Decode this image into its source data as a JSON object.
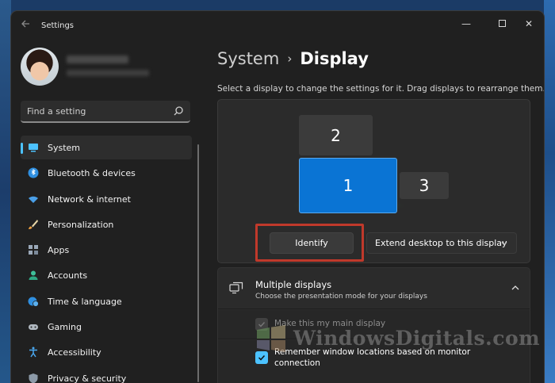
{
  "window": {
    "app_title": "Settings",
    "back_icon": "arrow-left-icon",
    "controls": {
      "minimize": "—",
      "close": "✕"
    }
  },
  "profile": {
    "name": "███████",
    "email": "████████████████"
  },
  "search": {
    "placeholder": "Find a setting",
    "icon": "search-icon"
  },
  "sidebar": {
    "items": [
      {
        "label": "System",
        "icon": "monitor-icon",
        "active": true
      },
      {
        "label": "Bluetooth & devices",
        "icon": "bluetooth-icon"
      },
      {
        "label": "Network & internet",
        "icon": "wifi-icon"
      },
      {
        "label": "Personalization",
        "icon": "brush-icon"
      },
      {
        "label": "Apps",
        "icon": "apps-icon"
      },
      {
        "label": "Accounts",
        "icon": "person-icon"
      },
      {
        "label": "Time & language",
        "icon": "globe-clock-icon"
      },
      {
        "label": "Gaming",
        "icon": "gamepad-icon"
      },
      {
        "label": "Accessibility",
        "icon": "accessibility-icon"
      },
      {
        "label": "Privacy & security",
        "icon": "shield-icon"
      }
    ]
  },
  "main": {
    "breadcrumb": {
      "parent": "System",
      "separator": "›",
      "current": "Display"
    },
    "instructions": "Select a display to change the settings for it. Drag displays to rearrange them.",
    "monitors": [
      {
        "number": "2",
        "selected": false
      },
      {
        "number": "1",
        "selected": true
      },
      {
        "number": "3",
        "selected": false
      }
    ],
    "identify_label": "Identify",
    "extend_select": {
      "value": "Extend desktop to this display"
    },
    "multiple_displays": {
      "title": "Multiple displays",
      "subtitle": "Choose the presentation mode for your displays",
      "options": [
        {
          "label": "Make this my main display",
          "checked": true,
          "disabled": true
        },
        {
          "label": "Remember window locations based on monitor connection",
          "checked": true,
          "disabled": false
        }
      ]
    }
  },
  "watermark": {
    "text": "WindowsDigitals.com"
  },
  "colors": {
    "accent": "#4cc2ff",
    "selected_monitor": "#0a74d4",
    "highlight_box": "#c0392b",
    "window_bg": "#202020"
  }
}
